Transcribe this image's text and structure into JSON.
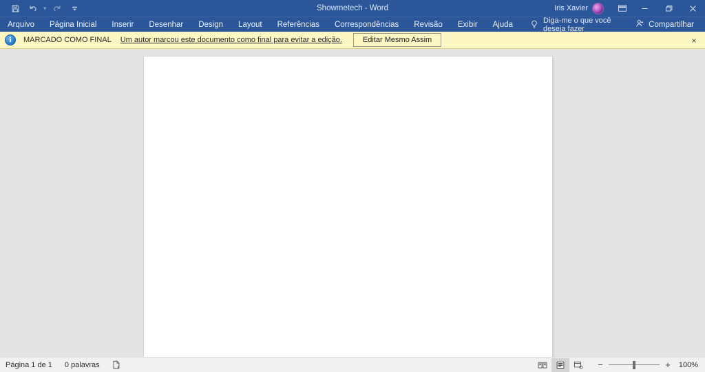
{
  "titlebar": {
    "document_title": "Showmetech  -  Word",
    "quick_access": [
      {
        "name": "save-icon",
        "label": "Salvar"
      },
      {
        "name": "undo-icon",
        "label": "Desfazer"
      },
      {
        "name": "redo-icon",
        "label": "Refazer"
      },
      {
        "name": "customize-quick-access-icon",
        "label": "Personalizar Barra de Ferramentas de Acesso Rápido"
      }
    ],
    "account_name": "Iris Xavier",
    "ribbon_display_options_label": "Opções de Exibição da Faixa de Opções",
    "minimize_label": "Minimizar",
    "restore_label": "Restaurar",
    "close_label": "Fechar"
  },
  "ribbon": {
    "tabs": [
      {
        "label": "Arquivo"
      },
      {
        "label": "Página Inicial"
      },
      {
        "label": "Inserir"
      },
      {
        "label": "Desenhar"
      },
      {
        "label": "Design"
      },
      {
        "label": "Layout"
      },
      {
        "label": "Referências"
      },
      {
        "label": "Correspondências"
      },
      {
        "label": "Revisão"
      },
      {
        "label": "Exibir"
      },
      {
        "label": "Ajuda"
      }
    ],
    "tell_me": "Diga-me o que você deseja fazer",
    "share_label": "Compartilhar"
  },
  "final_bar": {
    "status_label": "MARCADO COMO FINAL",
    "message": "Um autor marcou este documento como final para evitar a edição.",
    "edit_anyway_label": "Editar Mesmo Assim",
    "close_label": "×",
    "background_color": "#fdf7c3"
  },
  "statusbar": {
    "page_indicator": "Página 1 de 1",
    "word_count": "0 palavras",
    "proofing_label": "Verificação de texto",
    "views": [
      {
        "name": "read-mode-view",
        "label": "Modo de Leitura",
        "active": false
      },
      {
        "name": "print-layout-view",
        "label": "Layout de Impressão",
        "active": true
      },
      {
        "name": "web-layout-view",
        "label": "Layout da Web",
        "active": false
      }
    ],
    "zoom_out_label": "−",
    "zoom_in_label": "+",
    "zoom_level": "100%"
  },
  "colors": {
    "word_blue": "#2b579a",
    "final_yellow": "#fdf7c3",
    "canvas_gray": "#e4e4e4",
    "page_white": "#ffffff"
  }
}
